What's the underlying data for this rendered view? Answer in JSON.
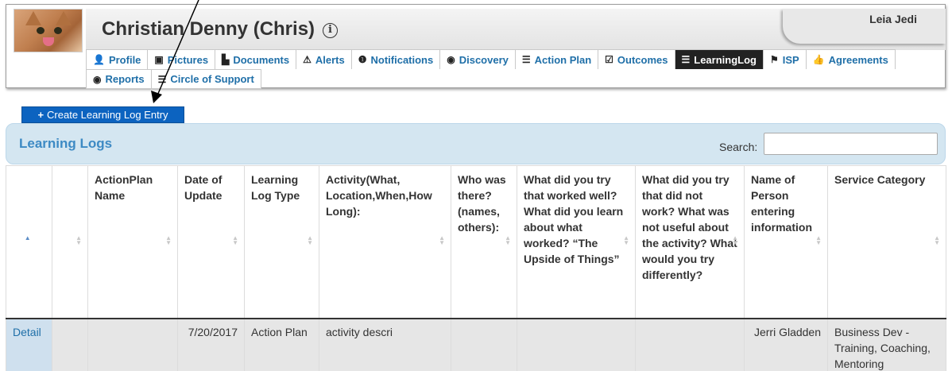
{
  "header": {
    "title": "Christian Denny (Chris)",
    "info_icon": "ⓘ",
    "user": "Leia Jedi"
  },
  "tabs_row1": [
    {
      "label": "Profile",
      "icon": "person-icon",
      "glyph": "👤"
    },
    {
      "label": "Pictures",
      "icon": "picture-icon",
      "glyph": "▣"
    },
    {
      "label": "Documents",
      "icon": "document-icon",
      "glyph": "▙"
    },
    {
      "label": "Alerts",
      "icon": "warning-icon",
      "glyph": "⚠"
    },
    {
      "label": "Notifications",
      "icon": "exclamation-circle-icon",
      "glyph": "❶"
    },
    {
      "label": "Discovery",
      "icon": "eye-icon",
      "glyph": "◉"
    },
    {
      "label": "Action Plan",
      "icon": "list-icon",
      "glyph": "☰"
    },
    {
      "label": "Outcomes",
      "icon": "check-square-icon",
      "glyph": "☑"
    },
    {
      "label": "LearningLog",
      "icon": "list-icon",
      "glyph": "☰"
    },
    {
      "label": "ISP",
      "icon": "flag-icon",
      "glyph": "⚑"
    },
    {
      "label": "Agreements",
      "icon": "thumbs-up-icon",
      "glyph": "👍"
    }
  ],
  "tabs_row2": [
    {
      "label": "Reports",
      "icon": "eye-icon",
      "glyph": "◉"
    },
    {
      "label": "Circle of Support",
      "icon": "list-icon",
      "glyph": "☰"
    }
  ],
  "active_tab": "LearningLog",
  "create_button": {
    "label": "Create Learning Log Entry",
    "icon": "plus-icon"
  },
  "logs_panel": {
    "title": "Learning Logs",
    "search_label": "Search:",
    "search_value": ""
  },
  "table": {
    "columns": [
      "",
      "",
      "ActionPlan Name",
      "Date of Update",
      "Learning Log Type",
      "Activity(What, Location,When,How Long):",
      "Who was there? (names, others):",
      "What did you try that worked well? What did you learn about what worked? “The Upside of Things”",
      "What did you try that did not work? What was not useful about the activity? What would you try differently?",
      "Name of Person entering information",
      "Service Category"
    ],
    "rows": [
      [
        "Detail",
        "",
        "",
        "7/20/2017",
        "Action Plan",
        "activity descri",
        "",
        "",
        "",
        "Jerri Gladden",
        "Business Dev - Training, Coaching, Mentoring"
      ]
    ]
  },
  "colors": {
    "accent": "#1f6fa8",
    "button": "#0c63c0",
    "panel": "#d4e6f1",
    "active_tab": "#222222"
  }
}
